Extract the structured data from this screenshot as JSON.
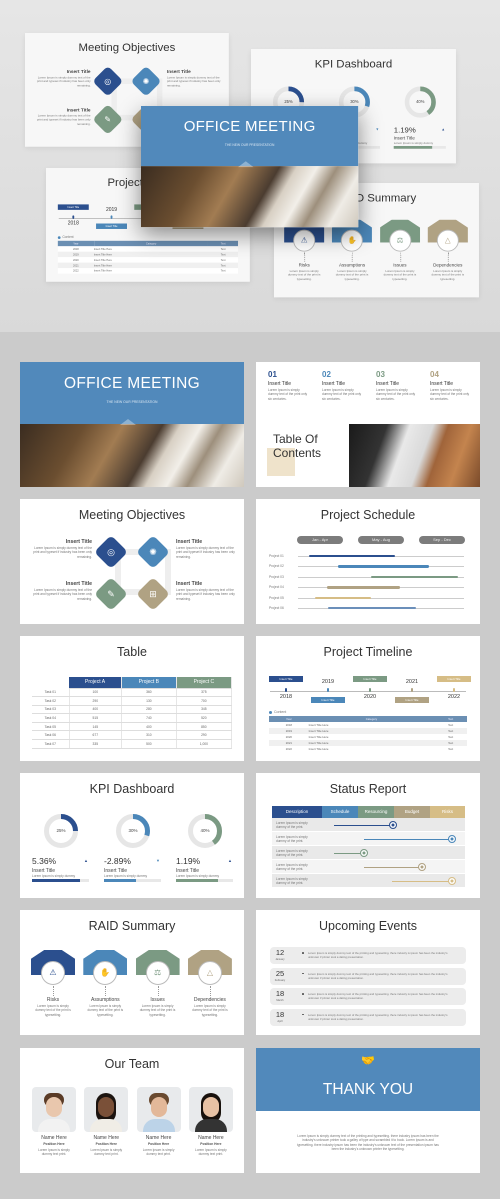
{
  "colors": {
    "navy": "#2b4f8e",
    "blue": "#4b87b9",
    "green": "#7b9a83",
    "tan": "#b0a283",
    "gold": "#d6bd86",
    "cover": "#5189bb",
    "gray_pill": "#7c7c7c"
  },
  "cover": {
    "title": "OFFICE MEETING",
    "subtitle": "THE NEW OUR PRESENTATION"
  },
  "toc": {
    "title_line1": "Table Of",
    "title_line2": "Contents",
    "items": [
      {
        "num": "01",
        "title": "Insert Title",
        "text": "Lorem Ipsum is simply dummy text of the print only six centuries."
      },
      {
        "num": "02",
        "title": "Insert Title",
        "text": "Lorem Ipsum is simply dummy text of the print only six centuries."
      },
      {
        "num": "03",
        "title": "Insert Title",
        "text": "Lorem Ipsum is simply dummy text of the print only six centuries."
      },
      {
        "num": "04",
        "title": "Insert Title",
        "text": "Lorem Ipsum is simply dummy text of the print only six centuries."
      }
    ]
  },
  "objectives": {
    "title": "Meeting Objectives",
    "items": [
      {
        "title": "Insert Title",
        "text": "Lorem Ipsum is simply dummy text of the print and typeset if industry has been only remaining.",
        "icon": "brain-icon"
      },
      {
        "title": "Insert Title",
        "text": "Lorem Ipsum is simply dummy text of the print and typeset if industry has been only remaining.",
        "icon": "atom-icon"
      },
      {
        "title": "Insert Title",
        "text": "Lorem Ipsum is simply dummy text of the print and typeset if industry has been only remaining.",
        "icon": "presentation-icon"
      },
      {
        "title": "Insert Title",
        "text": "Lorem Ipsum is simply dummy text of the print and typeset if industry has been only remaining.",
        "icon": "org-chart-icon"
      }
    ]
  },
  "schedule": {
    "title": "Project Schedule",
    "periods": [
      "Jan - Apr",
      "May - Aug",
      "Sep - Dec"
    ],
    "projects": [
      {
        "name": "Project 01",
        "start_month": 0.8,
        "end_month": 7.0,
        "color": "#2b4f8e"
      },
      {
        "name": "Project 02",
        "start_month": 2.9,
        "end_month": 9.5,
        "color": "#4b87b9"
      },
      {
        "name": "Project 03",
        "start_month": 5.3,
        "end_month": 11.6,
        "color": "#7b9a83"
      },
      {
        "name": "Project 04",
        "start_month": 2.1,
        "end_month": 7.4,
        "color": "#b0a283"
      },
      {
        "name": "Project 05",
        "start_month": 1.2,
        "end_month": 5.3,
        "color": "#d6bd86"
      },
      {
        "name": "Project 06",
        "start_month": 2.2,
        "end_month": 8.5,
        "color": "#6b8fba"
      }
    ]
  },
  "table": {
    "title": "Table",
    "columns": [
      "Project A",
      "Project B",
      "Project C"
    ],
    "rows": [
      [
        "Task 01",
        "100",
        "360",
        "375"
      ],
      [
        "Task 02",
        "290",
        "130",
        "700"
      ],
      [
        "Task 03",
        "400",
        "280",
        "345"
      ],
      [
        "Task 04",
        "515",
        "740",
        "520"
      ],
      [
        "Task 05",
        "145",
        "400",
        "850"
      ],
      [
        "Task 06",
        "677",
        "310",
        "290"
      ],
      [
        "Task 07",
        "335",
        "500",
        "1,000"
      ]
    ]
  },
  "timeline": {
    "title": "Project Timeline",
    "milestones": [
      {
        "year": "2018",
        "label": "Insert Title",
        "color": "#2b4f8e"
      },
      {
        "year": "2019",
        "label": "Insert Title",
        "color": "#4b87b9"
      },
      {
        "year": "2020",
        "label": "Insert Title",
        "color": "#7b9a83"
      },
      {
        "year": "2021",
        "label": "Insert Title",
        "color": "#b0a283"
      },
      {
        "year": "2022",
        "label": "Insert Title",
        "color": "#d6bd86"
      }
    ],
    "legend": "Content",
    "columns": [
      "Year",
      "Category",
      "Text"
    ],
    "rows": [
      [
        "2018",
        "Insert Title Here",
        "Text"
      ],
      [
        "2019",
        "Insert Title Here",
        "Text"
      ],
      [
        "2020",
        "Insert Title Here",
        "Text"
      ],
      [
        "2021",
        "Insert Title Here",
        "Text"
      ],
      [
        "2022",
        "Insert Title Here",
        "Text"
      ]
    ]
  },
  "kpi": {
    "title": "KPI Dashboard",
    "items": [
      {
        "percent": 25,
        "percent_label": "25%",
        "value": "5.36%",
        "trend": "up",
        "trend_glyph": "▲",
        "title": "Insert Title",
        "text": "Lorem Ipsum is simply dummy",
        "progress": 0.85,
        "color": "#2b4f8e"
      },
      {
        "percent": 30,
        "percent_label": "30%",
        "value": "-2.89%",
        "trend": "down",
        "trend_glyph": "▼",
        "title": "Insert Title",
        "text": "Lorem Ipsum is simply dummy",
        "progress": 0.56,
        "color": "#4b87b9"
      },
      {
        "percent": 40,
        "percent_label": "40%",
        "value": "1.19%",
        "trend": "up",
        "trend_glyph": "▲",
        "title": "Insert Title",
        "text": "Lorem Ipsum is simply dummy",
        "progress": 0.73,
        "color": "#7b9a83"
      }
    ]
  },
  "status": {
    "title": "Status Report",
    "headers": [
      "Description",
      "Schedule",
      "Resourcing",
      "Budget",
      "Risks"
    ],
    "header_colors": [
      "#2b4f8e",
      "#4b87b9",
      "#7b9a83",
      "#b0a283",
      "#d6bd86"
    ],
    "rows": [
      {
        "text": "Lorem Ipsum is simply dummy of the print.",
        "start": 0.33,
        "end": 1.97,
        "color": "#2b4f8e"
      },
      {
        "text": "Lorem Ipsum is simply dummy of the print.",
        "start": 1.17,
        "end": 3.6,
        "color": "#4b87b9"
      },
      {
        "text": "Lorem Ipsum is simply dummy of the print.",
        "start": 0.33,
        "end": 1.17,
        "color": "#7b9a83"
      },
      {
        "text": "Lorem Ipsum is simply dummy of the print.",
        "start": 1.17,
        "end": 2.78,
        "color": "#b0a283"
      },
      {
        "text": "Lorem Ipsum is simply dummy of the print.",
        "start": 1.95,
        "end": 3.6,
        "color": "#d6bd86"
      }
    ]
  },
  "raid": {
    "title": "RAID Summary",
    "items": [
      {
        "label": "Risks",
        "text": "Lorem Ipsum is simply dummy text of the print is typesetting.",
        "color": "#2b4f8e",
        "icon": "risk-icon",
        "glyph": "⚠"
      },
      {
        "label": "Assumptions",
        "text": "Lorem Ipsum is simply dummy text of the print is typesetting.",
        "color": "#4b87b9",
        "icon": "handshake-icon",
        "glyph": "✋"
      },
      {
        "label": "Issues",
        "text": "Lorem Ipsum is simply dummy text of the print is typesetting.",
        "color": "#7b9a83",
        "icon": "scale-icon",
        "glyph": "⚖"
      },
      {
        "label": "Dependencies",
        "text": "Lorem Ipsum is simply dummy text of the print is typesetting.",
        "color": "#b0a283",
        "icon": "triangle-icon",
        "glyph": "△"
      }
    ]
  },
  "events": {
    "title": "Upcoming Events",
    "items": [
      {
        "day": "12",
        "month": "January",
        "text": "Lorem Ipsum is simply dummy text of the printing and typesetting. there industry is ipsum has been the industry's unknown if printer took a dating presentation."
      },
      {
        "day": "25",
        "month": "February",
        "text": "Lorem Ipsum is simply dummy text of the printing and typesetting. there industry is ipsum has been the industry's unknown if printer took a dating presentation."
      },
      {
        "day": "18",
        "month": "March",
        "text": "Lorem Ipsum is simply dummy text of the printing and typesetting. there industry is ipsum has been the industry's unknown if printer took a dating presentation."
      },
      {
        "day": "18",
        "month": "April",
        "text": "Lorem Ipsum is simply dummy text of the printing and typesetting. there industry is ipsum has been the industry's unknown if printer took a dating presentation."
      }
    ]
  },
  "team": {
    "title": "Our Team",
    "members": [
      {
        "name": "Name Here",
        "position": "Position Here",
        "text": "Lorem Ipsum is simply dummy text print."
      },
      {
        "name": "Name Here",
        "position": "Position Here",
        "text": "Lorem Ipsum is simply dummy text print."
      },
      {
        "name": "Name Here",
        "position": "Position Here",
        "text": "Lorem Ipsum is simply dummy text print."
      },
      {
        "name": "Name Here",
        "position": "Position Here",
        "text": "Lorem Ipsum is simply dummy text print."
      }
    ]
  },
  "thanks": {
    "title": "THANK YOU",
    "text": "Lorem Ipsum is simply dummy text of the printing and typesetting. there industry ipsum has been the industry's unknown printer took a galley of type and scrambled it to book. Lorem Ipsum is and typesetting. there industry ipsum has been the industry's unknown text of the presentation ipsum has been the industry's unknown printer the typesetting."
  }
}
